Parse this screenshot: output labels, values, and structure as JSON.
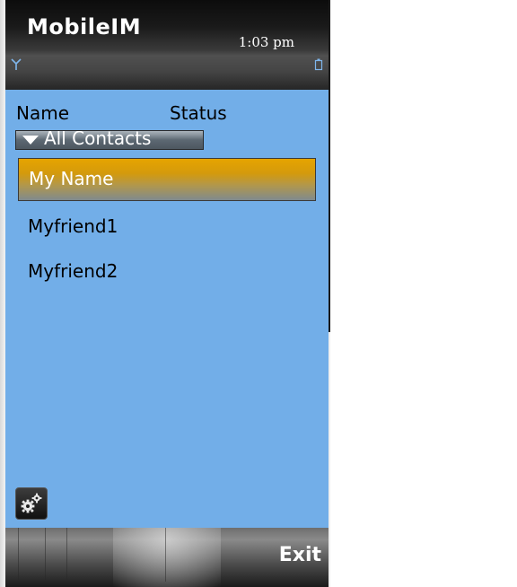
{
  "app": {
    "title": "MobileIM",
    "clock": "1:03 pm"
  },
  "status_icons": {
    "signal": "signal-antenna-icon",
    "battery": "battery-icon"
  },
  "columns": {
    "name": "Name",
    "status": "Status"
  },
  "filter": {
    "selected": "All Contacts"
  },
  "contacts": [
    {
      "label": "My Name",
      "selected": true
    },
    {
      "label": "Myfriend1",
      "selected": false
    },
    {
      "label": "Myfriend2",
      "selected": false
    }
  ],
  "toolbar": {
    "settings_icon": "gears-icon"
  },
  "softkeys": {
    "right": "Exit"
  },
  "colors": {
    "content_background": "#72aee8",
    "selection_highlight": "#e6a400"
  }
}
